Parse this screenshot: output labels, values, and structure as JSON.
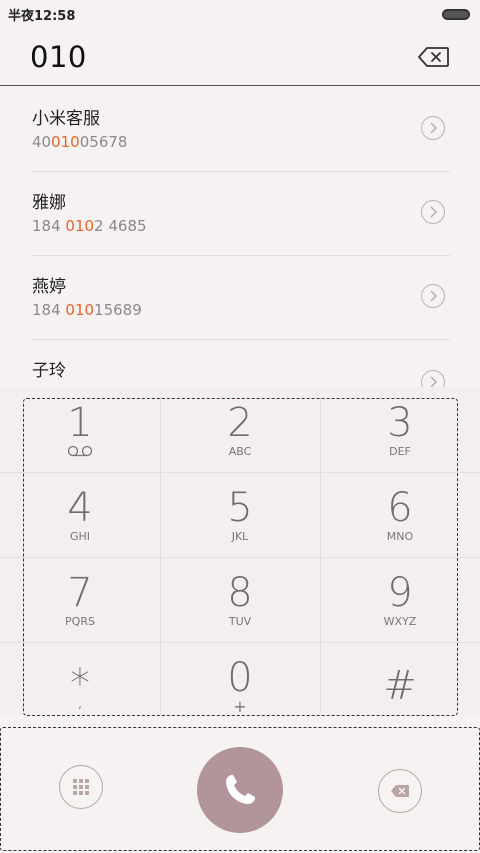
{
  "status": {
    "time": "半夜12:58"
  },
  "dial": {
    "number": "010"
  },
  "contacts": [
    {
      "name": "小米客服",
      "num_pre": "40",
      "num_hl": "010",
      "num_post": "05678"
    },
    {
      "name": "雅娜",
      "num_pre": "184 ",
      "num_hl": "010",
      "num_post": "2 4685"
    },
    {
      "name": "燕婷",
      "num_pre": "184 ",
      "num_hl": "010",
      "num_post": "15689"
    },
    {
      "name": "子玲",
      "num_pre": "",
      "num_hl": "",
      "num_post": ""
    }
  ],
  "keys": [
    {
      "digit": "1",
      "letters": ""
    },
    {
      "digit": "2",
      "letters": "ABC"
    },
    {
      "digit": "3",
      "letters": "DEF"
    },
    {
      "digit": "4",
      "letters": "GHI"
    },
    {
      "digit": "5",
      "letters": "JKL"
    },
    {
      "digit": "6",
      "letters": "MNO"
    },
    {
      "digit": "7",
      "letters": "PQRS"
    },
    {
      "digit": "8",
      "letters": "TUV"
    },
    {
      "digit": "9",
      "letters": "WXYZ"
    },
    {
      "digit": "*",
      "letters": ","
    },
    {
      "digit": "0",
      "letters": "+"
    },
    {
      "digit": "#",
      "letters": ""
    }
  ],
  "icons": {
    "voicemail": "voicemail-icon",
    "keypad_toggle": "keypad-grid-icon",
    "call": "phone-handset-icon",
    "delete": "backspace-icon",
    "detail": "chevron-right-icon"
  },
  "colors": {
    "accent": "#e8622a",
    "call_button": "#b2959b"
  }
}
